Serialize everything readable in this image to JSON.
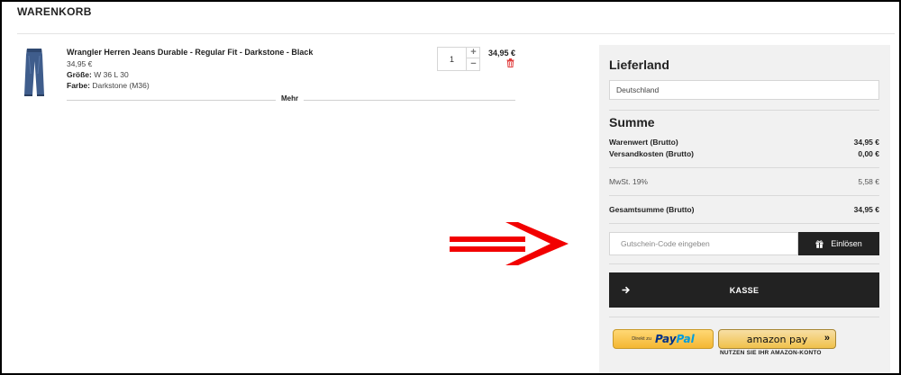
{
  "page": {
    "title": "WARENKORB"
  },
  "cart": {
    "item": {
      "name": "Wrangler Herren Jeans Durable - Regular Fit - Darkstone - Black",
      "unit_price": "34,95 €",
      "size_label": "Größe:",
      "size_value": "W 36 L 30",
      "color_label": "Farbe:",
      "color_value": "Darkstone (M36)",
      "quantity": "1",
      "plus_symbol": "+",
      "minus_symbol": "−",
      "line_total": "34,95 €",
      "image_icon": "jeans-icon",
      "delete_icon": "trash-icon"
    },
    "more_label": "Mehr"
  },
  "sidebar": {
    "country_heading": "Lieferland",
    "country_value": "Deutschland",
    "sum_heading": "Summe",
    "rows": [
      {
        "label": "Warenwert (Brutto)",
        "value": "34,95 €"
      },
      {
        "label": "Versandkosten (Brutto)",
        "value": "0,00 €"
      },
      {
        "label": "MwSt. 19%",
        "value": "5,58 €"
      },
      {
        "label": "Gesamtsumme (Brutto)",
        "value": "34,95 €"
      }
    ],
    "coupon_placeholder": "Gutschein-Code eingeben",
    "coupon_button": "Einlösen",
    "coupon_icon": "gift-icon",
    "checkout_button": "KASSE",
    "checkout_icon": "arrow-right-icon",
    "paypal": {
      "prefix": "Direkt zu",
      "logo_pay": "Pay",
      "logo_pal": "Pal"
    },
    "amazon": {
      "logo": "amazon pay",
      "chevron": "»",
      "subtitle": "NUTZEN SIE IHR AMAZON-KONTO"
    }
  },
  "annotation": {
    "arrow_color": "#f20000",
    "arrow_icon": "right-arrow-icon"
  },
  "colors": {
    "button_dark": "#222222",
    "panel_bg": "#f1f1f1",
    "delete_red": "#e03a3a"
  }
}
